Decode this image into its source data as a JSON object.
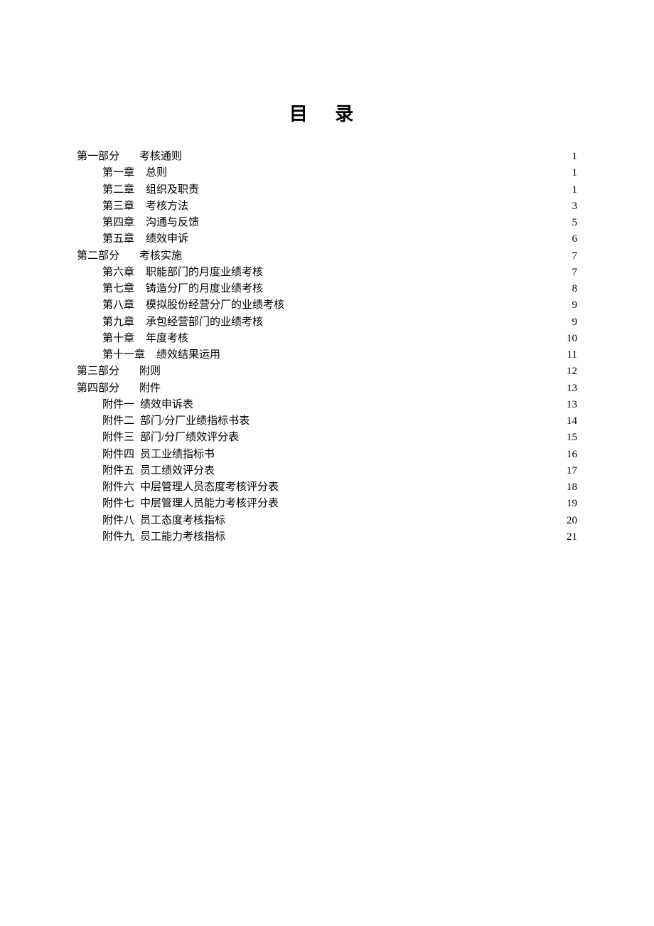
{
  "title": "目 录",
  "entries": [
    {
      "indent": 0,
      "labelClass": "gap-wide",
      "label": "第一部分",
      "text": "考核通则",
      "leader": "sparse",
      "page": "1"
    },
    {
      "indent": 1,
      "labelClass": "gap-med",
      "label": "第一章",
      "text": "总则",
      "leader": "dense",
      "page": "1"
    },
    {
      "indent": 1,
      "labelClass": "gap-med",
      "label": "第二章",
      "text": "组织及职责",
      "leader": "dense",
      "page": "1"
    },
    {
      "indent": 1,
      "labelClass": "gap-med",
      "label": "第三章",
      "text": "考核方法",
      "leader": "dense",
      "page": "3"
    },
    {
      "indent": 1,
      "labelClass": "gap-med",
      "label": "第四章",
      "text": "沟通与反馈",
      "leader": "dense",
      "page": "5"
    },
    {
      "indent": 1,
      "labelClass": "gap-med",
      "label": "第五章",
      "text": "绩效申诉",
      "leader": "dense",
      "page": "6"
    },
    {
      "indent": 0,
      "labelClass": "gap-wide",
      "label": "第二部分",
      "text": "考核实施",
      "leader": "sparse",
      "page": "7"
    },
    {
      "indent": 1,
      "labelClass": "gap-med",
      "label": "第六章",
      "text": "职能部门的月度业绩考核",
      "leader": "dense",
      "page": "7"
    },
    {
      "indent": 1,
      "labelClass": "gap-med",
      "label": "第七章",
      "text": "铸造分厂的月度业绩考核",
      "leader": "dense",
      "page": "8"
    },
    {
      "indent": 1,
      "labelClass": "gap-med",
      "label": "第八章",
      "text": "模拟股份经营分厂的业绩考核",
      "leader": "dense",
      "page": "9"
    },
    {
      "indent": 1,
      "labelClass": "gap-med",
      "label": "第九章",
      "text": "承包经营部门的业绩考核",
      "leader": "dense",
      "page": "9"
    },
    {
      "indent": 1,
      "labelClass": "gap-med",
      "label": "第十章",
      "text": "年度考核",
      "leader": "dense",
      "page": "10"
    },
    {
      "indent": 1,
      "labelClass": "gap-med",
      "label": "第十一章",
      "text": "绩效结果运用",
      "leader": "dense",
      "page": "11"
    },
    {
      "indent": 0,
      "labelClass": "gap-wide",
      "label": "第三部分",
      "text": "附则",
      "leader": "sparse",
      "page": "12"
    },
    {
      "indent": 0,
      "labelClass": "gap-wide",
      "label": "第四部分",
      "text": "附件",
      "leader": "sparse",
      "page": "13"
    },
    {
      "indent": 1,
      "labelClass": "gap-sm",
      "label": "附件一",
      "text": "绩效申诉表",
      "leader": "dense",
      "page": "13"
    },
    {
      "indent": 1,
      "labelClass": "gap-sm",
      "label": "附件二",
      "text": "部门/分厂业绩指标书表",
      "leader": "dense",
      "page": "14"
    },
    {
      "indent": 1,
      "labelClass": "gap-sm",
      "label": "附件三",
      "text": "部门/分厂绩效评分表",
      "leader": "dense",
      "page": "15"
    },
    {
      "indent": 1,
      "labelClass": "gap-sm",
      "label": "附件四",
      "text": "员工业绩指标书",
      "leader": "dense",
      "page": "16"
    },
    {
      "indent": 1,
      "labelClass": "gap-sm",
      "label": "附件五",
      "text": "员工绩效评分表",
      "leader": "dense",
      "page": "17"
    },
    {
      "indent": 1,
      "labelClass": "gap-sm",
      "label": "附件六",
      "text": "中层管理人员态度考核评分表",
      "leader": "dense",
      "page": "18"
    },
    {
      "indent": 1,
      "labelClass": "gap-sm",
      "label": "附件七",
      "text": "中层管理人员能力考核评分表",
      "leader": "dense",
      "page": "19"
    },
    {
      "indent": 1,
      "labelClass": "gap-sm",
      "label": "附件八",
      "text": "员工态度考核指标",
      "leader": "dense",
      "page": "20"
    },
    {
      "indent": 1,
      "labelClass": "gap-sm",
      "label": "附件九",
      "text": "员工能力考核指标",
      "leader": "dense",
      "page": "21"
    }
  ]
}
